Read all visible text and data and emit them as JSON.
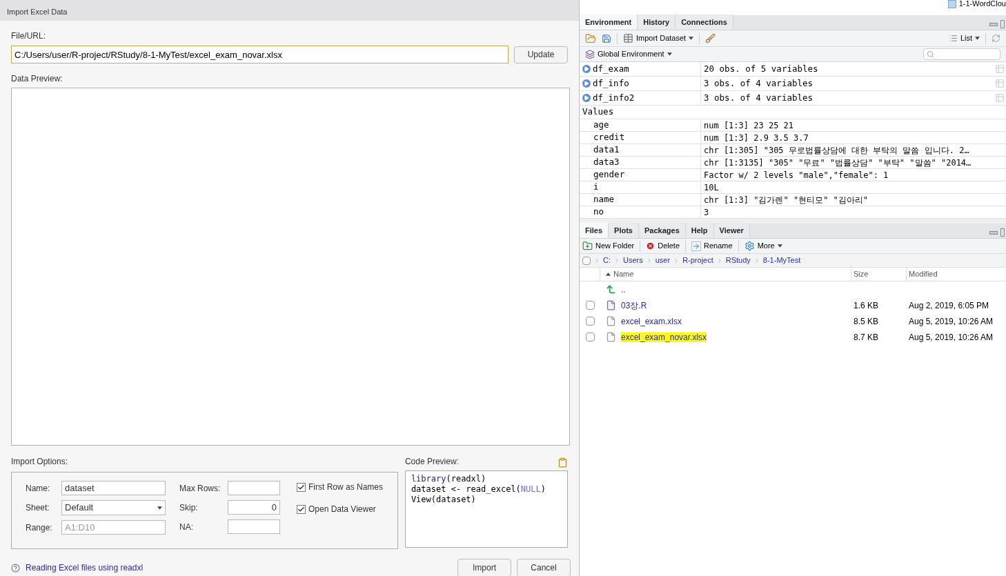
{
  "dialog": {
    "title": "Import Excel Data",
    "file_label": "File/URL:",
    "file_value": "C:/Users/user/R-project/RStudy/8-1-MyTest/excel_exam_novar.xlsx",
    "update_button": "Update",
    "preview_label": "Data Preview:",
    "options_label": "Import Options:",
    "fields_left": [
      {
        "label": "Name:",
        "kind": "text",
        "value": "dataset"
      },
      {
        "label": "Sheet:",
        "kind": "select",
        "value": "Default"
      },
      {
        "label": "Range:",
        "kind": "text",
        "placeholder": "A1:D10"
      }
    ],
    "fields_right": [
      {
        "label": "Max Rows:",
        "kind": "number"
      },
      {
        "label": "Skip:",
        "kind": "number",
        "value": "0"
      },
      {
        "label": "NA:",
        "kind": "text"
      }
    ],
    "checkboxes": [
      {
        "label": "First Row as Names",
        "checked": true
      },
      {
        "label": "Open Data Viewer",
        "checked": true
      }
    ],
    "code_label": "Code Preview:",
    "code_lines": [
      [
        {
          "text": "library",
          "kind": "function"
        },
        {
          "text": "(readxl)",
          "kind": "plain"
        }
      ],
      [
        {
          "text": "dataset <- read_excel(",
          "kind": "plain"
        },
        {
          "text": "NULL",
          "kind": "constant"
        },
        {
          "text": ")",
          "kind": "plain"
        }
      ],
      [
        {
          "text": "View(dataset)",
          "kind": "plain"
        }
      ]
    ],
    "help_link": "Reading Excel files using readxl",
    "buttons": [
      "Import",
      "Cancel"
    ]
  },
  "top_bar": {
    "project": "1-1-WordClou"
  },
  "env_pane": {
    "tabs": [
      {
        "label": "Environment",
        "selected": true
      },
      {
        "label": "History",
        "selected": false
      },
      {
        "label": "Connections",
        "selected": false
      }
    ],
    "import_dataset": "Import Dataset",
    "view_mode": "List",
    "scope": "Global Environment",
    "data": [
      {
        "name": "df_exam",
        "value": "20 obs. of 5 variables"
      },
      {
        "name": "df_info",
        "value": "3 obs. of 4 variables"
      },
      {
        "name": "df_info2",
        "value": "3 obs. of 4 variables"
      }
    ],
    "values_header": "Values",
    "values": [
      {
        "name": "age",
        "value": "num [1:3] 23 25 21"
      },
      {
        "name": "credit",
        "value": "num [1:3] 2.9 3.5 3.7"
      },
      {
        "name": "data1",
        "value": "chr [1:305] \"305 무로법률상담에 대한 부탁의 말씀 입니다. 2…"
      },
      {
        "name": "data3",
        "value": "chr [1:3135] \"305\" \"무료\" \"법률상담\" \"부탁\" \"말씀\" \"2014…"
      },
      {
        "name": "gender",
        "value": "Factor w/ 2 levels \"male\",\"female\": 1"
      },
      {
        "name": "i",
        "value": "10L"
      },
      {
        "name": "name",
        "value": "chr [1:3] \"김가렌\" \"현티모\" \"김아리\""
      },
      {
        "name": "no",
        "value": "3"
      }
    ]
  },
  "files_pane": {
    "tabs": [
      {
        "label": "Files",
        "selected": true
      },
      {
        "label": "Plots",
        "selected": false
      },
      {
        "label": "Packages",
        "selected": false
      },
      {
        "label": "Help",
        "selected": false
      },
      {
        "label": "Viewer",
        "selected": false
      }
    ],
    "toolbar": [
      {
        "kind": "new-folder",
        "label": "New Folder"
      },
      {
        "kind": "delete",
        "label": "Delete"
      },
      {
        "kind": "rename",
        "label": "Rename"
      },
      {
        "kind": "more",
        "label": "More"
      }
    ],
    "select_all_checked": false,
    "path": [
      "C:",
      "Users",
      "user",
      "R-project",
      "RStudy",
      "8-1-MyTest"
    ],
    "columns": [
      "Name",
      "Size",
      "Modified"
    ],
    "rows": [
      {
        "kind": "parent",
        "name": ".."
      },
      {
        "kind": "r-script",
        "name": "03장.R",
        "size": "1.6 KB",
        "modified": "Aug 2, 2019, 6:05 PM",
        "checked": false,
        "highlighted": false
      },
      {
        "kind": "file",
        "name": "excel_exam.xlsx",
        "size": "8.5 KB",
        "modified": "Aug 5, 2019, 10:26 AM",
        "checked": false,
        "highlighted": false
      },
      {
        "kind": "file",
        "name": "excel_exam_novar.xlsx",
        "size": "8.7 KB",
        "modified": "Aug 5, 2019, 10:26 AM",
        "checked": false,
        "highlighted": true
      }
    ]
  }
}
